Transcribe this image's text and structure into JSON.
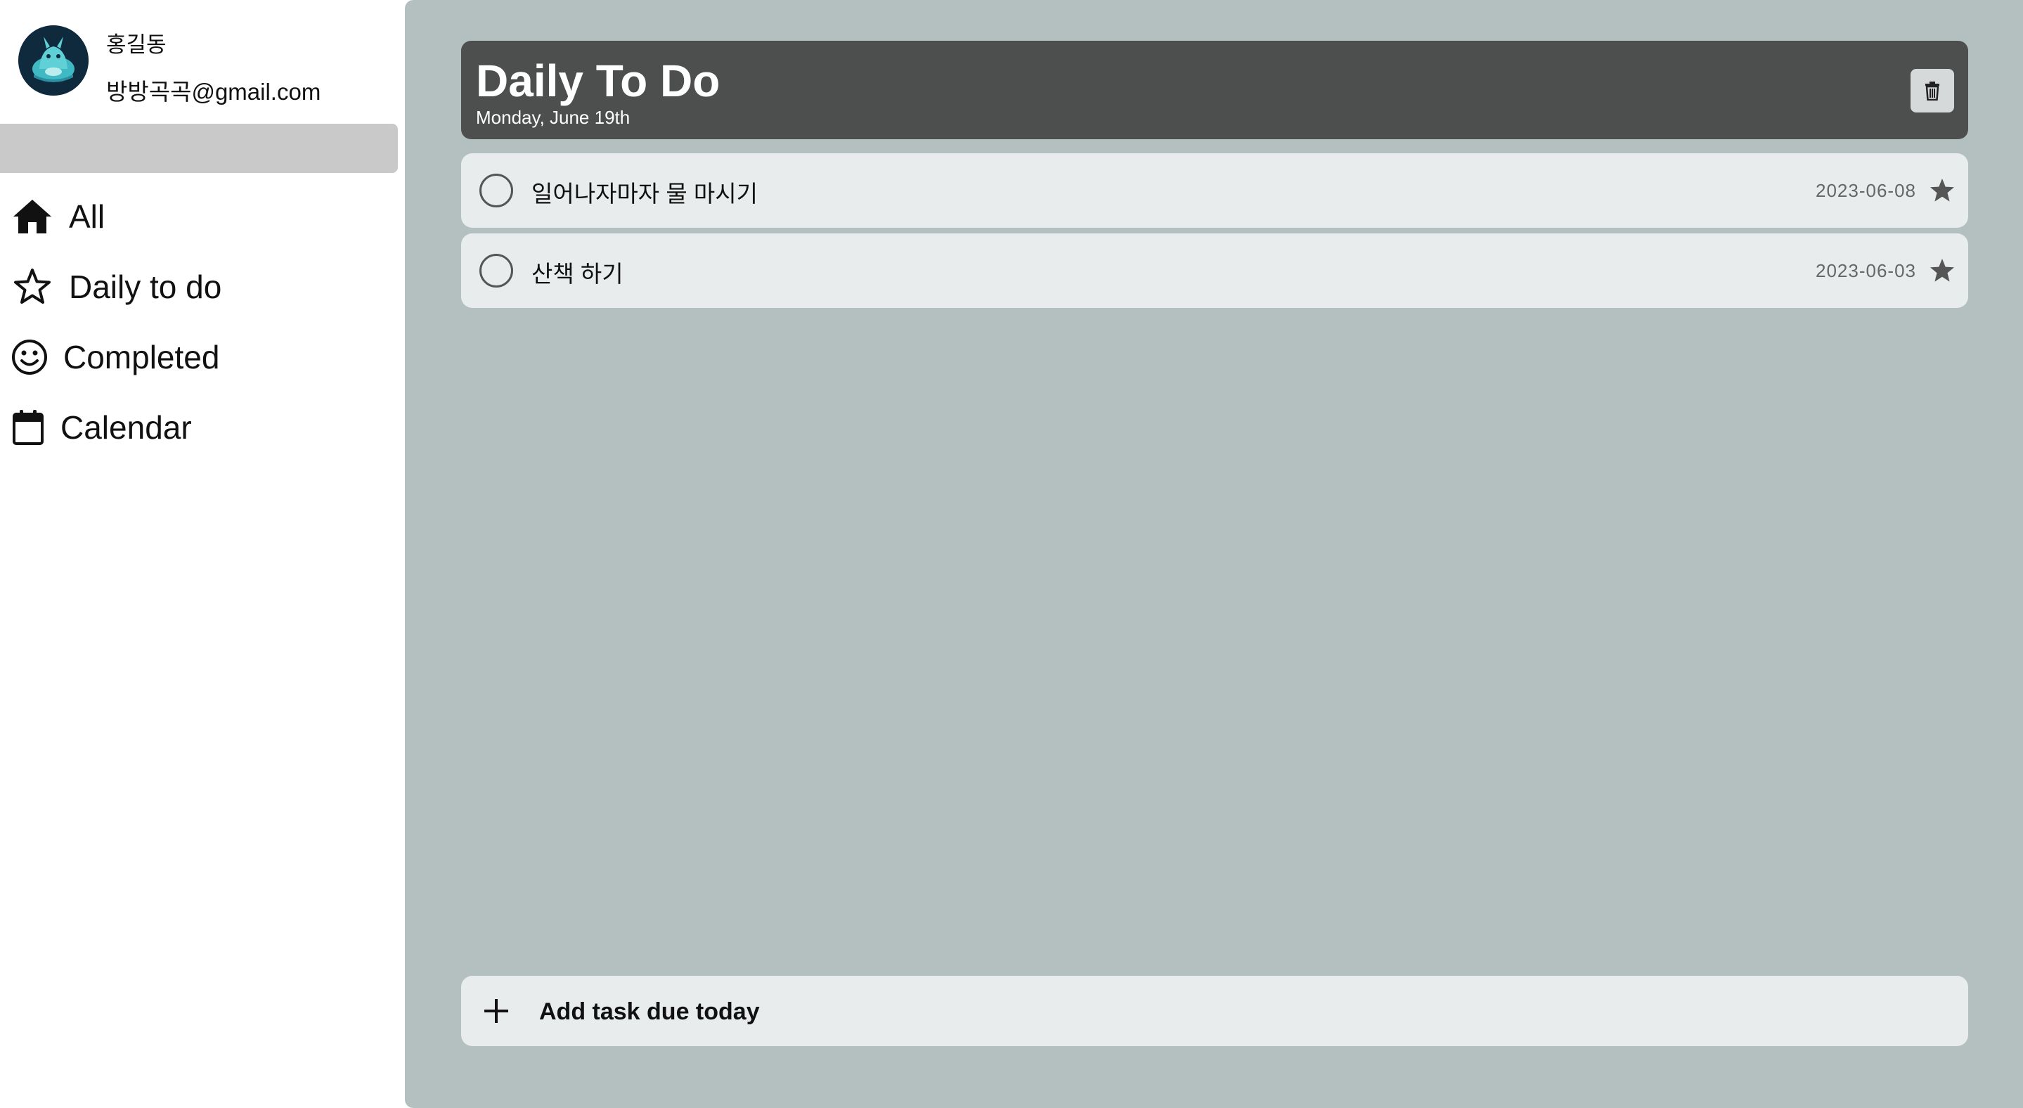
{
  "profile": {
    "name": "홍길동",
    "email": "방방곡곡@gmail.com"
  },
  "sidebar": {
    "items": [
      {
        "label": "All",
        "icon": "home-icon"
      },
      {
        "label": "Daily to do",
        "icon": "star-outline-icon"
      },
      {
        "label": "Completed",
        "icon": "smiley-icon"
      },
      {
        "label": "Calendar",
        "icon": "calendar-icon"
      }
    ]
  },
  "header": {
    "title": "Daily To Do",
    "date": "Monday, June 19th",
    "delete_icon": "trash-icon"
  },
  "tasks": [
    {
      "text": "일어나자마자 물 마시기",
      "date": "2023-06-08",
      "starred": true
    },
    {
      "text": "산책 하기",
      "date": "2023-06-03",
      "starred": true
    }
  ],
  "add_task": {
    "label": "Add task due today",
    "icon": "plus-icon"
  },
  "colors": {
    "main_bg": "#b4c0c0",
    "header_bg": "#4d4e4e",
    "card_bg": "#e8ecec",
    "search_bar": "#c9c9c9"
  }
}
